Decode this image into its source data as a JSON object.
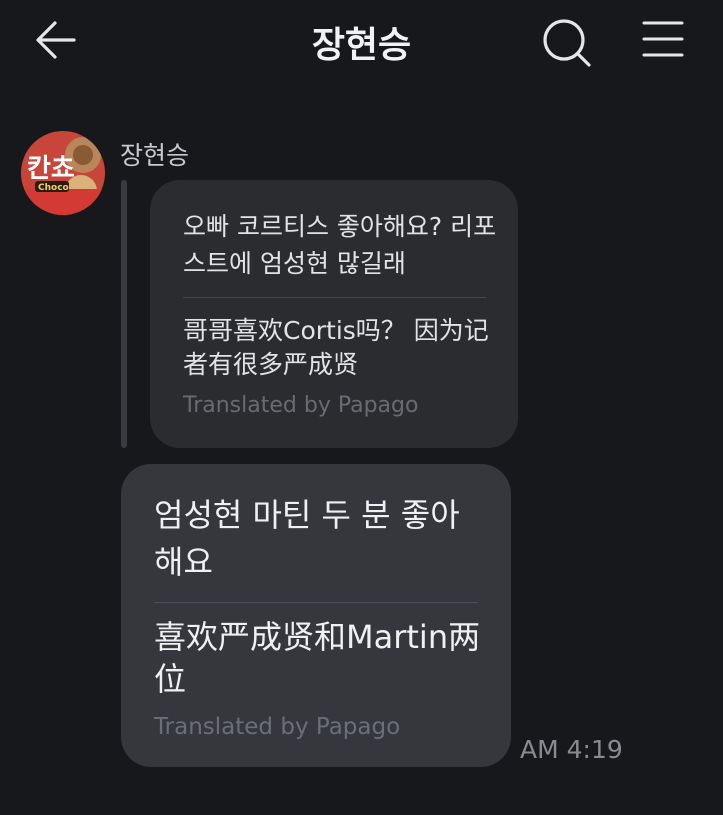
{
  "header": {
    "title": "장현승",
    "back_icon": "arrow-left-icon",
    "search_icon": "search-icon",
    "menu_icon": "menu-icon"
  },
  "message": {
    "sender_name": "장현승",
    "avatar": {
      "badge_text": "칸쵸",
      "sub_text": "Choco"
    },
    "quoted": {
      "text": "오빠 코르티스 좋아해요? 리포스트에 엄성현 많길래",
      "translation": "哥哥喜欢Cortis吗？ 因为记者有很多严成贤",
      "translated_by": "Translated by Papago"
    },
    "reply": {
      "text": "엄성현 마틴 두 분 좋아해요",
      "translation": "喜欢严成贤和Martin两位",
      "translated_by": "Translated by Papago"
    },
    "timestamp": "AM 4:19"
  },
  "colors": {
    "background": "#17181c",
    "bubble_quoted": "#2b2c30",
    "bubble_main": "#35373d",
    "muted_text": "#6a6b72"
  }
}
